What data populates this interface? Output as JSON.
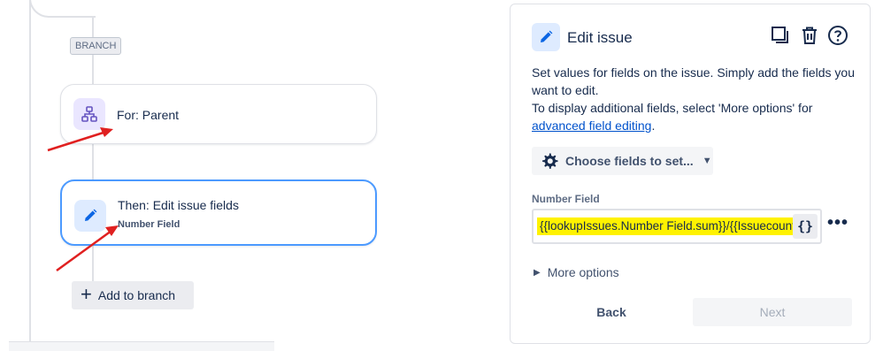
{
  "canvas": {
    "branch_tag": "BRANCH",
    "parent_node": {
      "title": "For: Parent",
      "icon": "hierarchy-icon"
    },
    "edit_node": {
      "title": "Then: Edit issue fields",
      "subtitle": "Number Field",
      "icon": "pencil-icon"
    },
    "add_branch_label": "Add to branch",
    "annotation_color": "#e02020"
  },
  "panel": {
    "title": "Edit issue",
    "icon": "pencil-icon",
    "tools": [
      "duplicate-icon",
      "trash-icon",
      "help-icon"
    ],
    "desc_line1": "Set values for fields on the issue. Simply add the fields you want to edit.",
    "desc_line2": "To display additional fields, select 'More options' for",
    "desc_link": "advanced field editing",
    "desc_end": ".",
    "choose_label": "Choose fields to set...",
    "field_label": "Number Field",
    "field_value": "{{lookupIssues.Number Field.sum}}/{{Issuecount",
    "smart_value_label": "{}",
    "more_dots": "•••",
    "more_options_label": "More options",
    "back_label": "Back",
    "next_label": "Next",
    "highlight_color": "#fff200"
  }
}
